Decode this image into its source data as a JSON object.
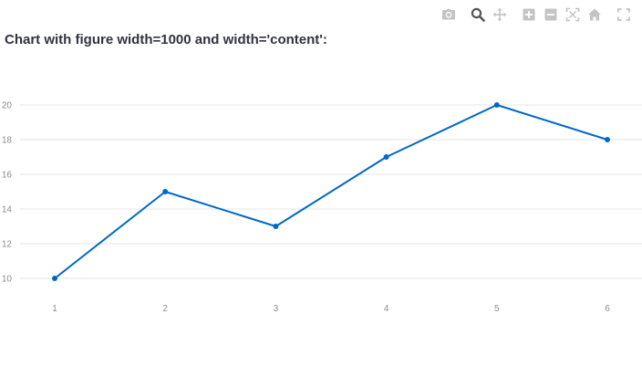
{
  "header": {
    "title": "Chart with figure width=1000 and width='content':"
  },
  "modebar": {
    "buttons": [
      {
        "icon": "camera-icon",
        "name": "download-png-button",
        "active": false
      },
      {
        "icon": "zoom-icon",
        "name": "zoom-button",
        "active": true
      },
      {
        "icon": "pan-icon",
        "name": "pan-button",
        "active": false
      },
      {
        "icon": "zoom-in-icon",
        "name": "zoom-in-button",
        "active": false
      },
      {
        "icon": "zoom-out-icon",
        "name": "zoom-out-button",
        "active": false
      },
      {
        "icon": "autoscale-icon",
        "name": "autoscale-button",
        "active": false
      },
      {
        "icon": "home-icon",
        "name": "reset-axes-button",
        "active": false
      },
      {
        "icon": "fullscreen-icon",
        "name": "fullscreen-button",
        "active": false
      }
    ],
    "icon_color": "#c4c4c8",
    "active_icon_color": "#55555d"
  },
  "chart_data": {
    "type": "line",
    "title": "",
    "xlabel": "",
    "ylabel": "",
    "x": [
      1,
      2,
      3,
      4,
      5,
      6
    ],
    "series": [
      {
        "values": [
          10,
          15,
          13,
          17,
          20,
          18
        ],
        "color": "#0068c9",
        "markers": true
      }
    ],
    "xticks": [
      1,
      2,
      3,
      4,
      5,
      6
    ],
    "yticks": [
      10,
      12,
      14,
      16,
      18,
      20
    ],
    "xlim": [
      1,
      6
    ],
    "ylim": [
      10,
      20
    ],
    "grid": true,
    "grid_color": "#e6e6ea",
    "tick_label_color": "#8c8c94"
  }
}
